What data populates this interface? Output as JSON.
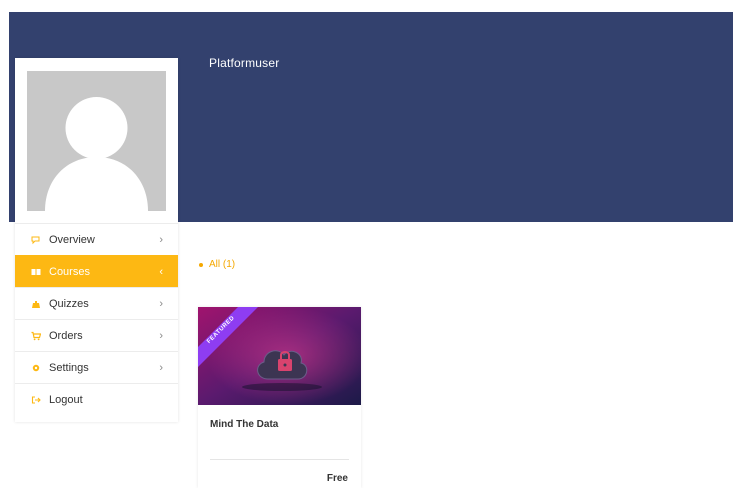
{
  "profile": {
    "username": "Platformuser"
  },
  "menu": {
    "items": [
      {
        "label": "Overview",
        "icon": "overview-icon",
        "active": false
      },
      {
        "label": "Courses",
        "icon": "courses-icon",
        "active": true
      },
      {
        "label": "Quizzes",
        "icon": "quizzes-icon",
        "active": false
      },
      {
        "label": "Orders",
        "icon": "cart-icon",
        "active": false
      },
      {
        "label": "Settings",
        "icon": "gear-icon",
        "active": false
      },
      {
        "label": "Logout",
        "icon": "logout-icon",
        "active": false
      }
    ]
  },
  "filters": {
    "all_label": "All (1)"
  },
  "courses": [
    {
      "title": "Mind The Data",
      "price": "Free",
      "badge": "FEATURED"
    }
  ],
  "colors": {
    "banner": "#33416e",
    "accent": "#fdb813",
    "featured_ribbon": "#8e3df2"
  }
}
